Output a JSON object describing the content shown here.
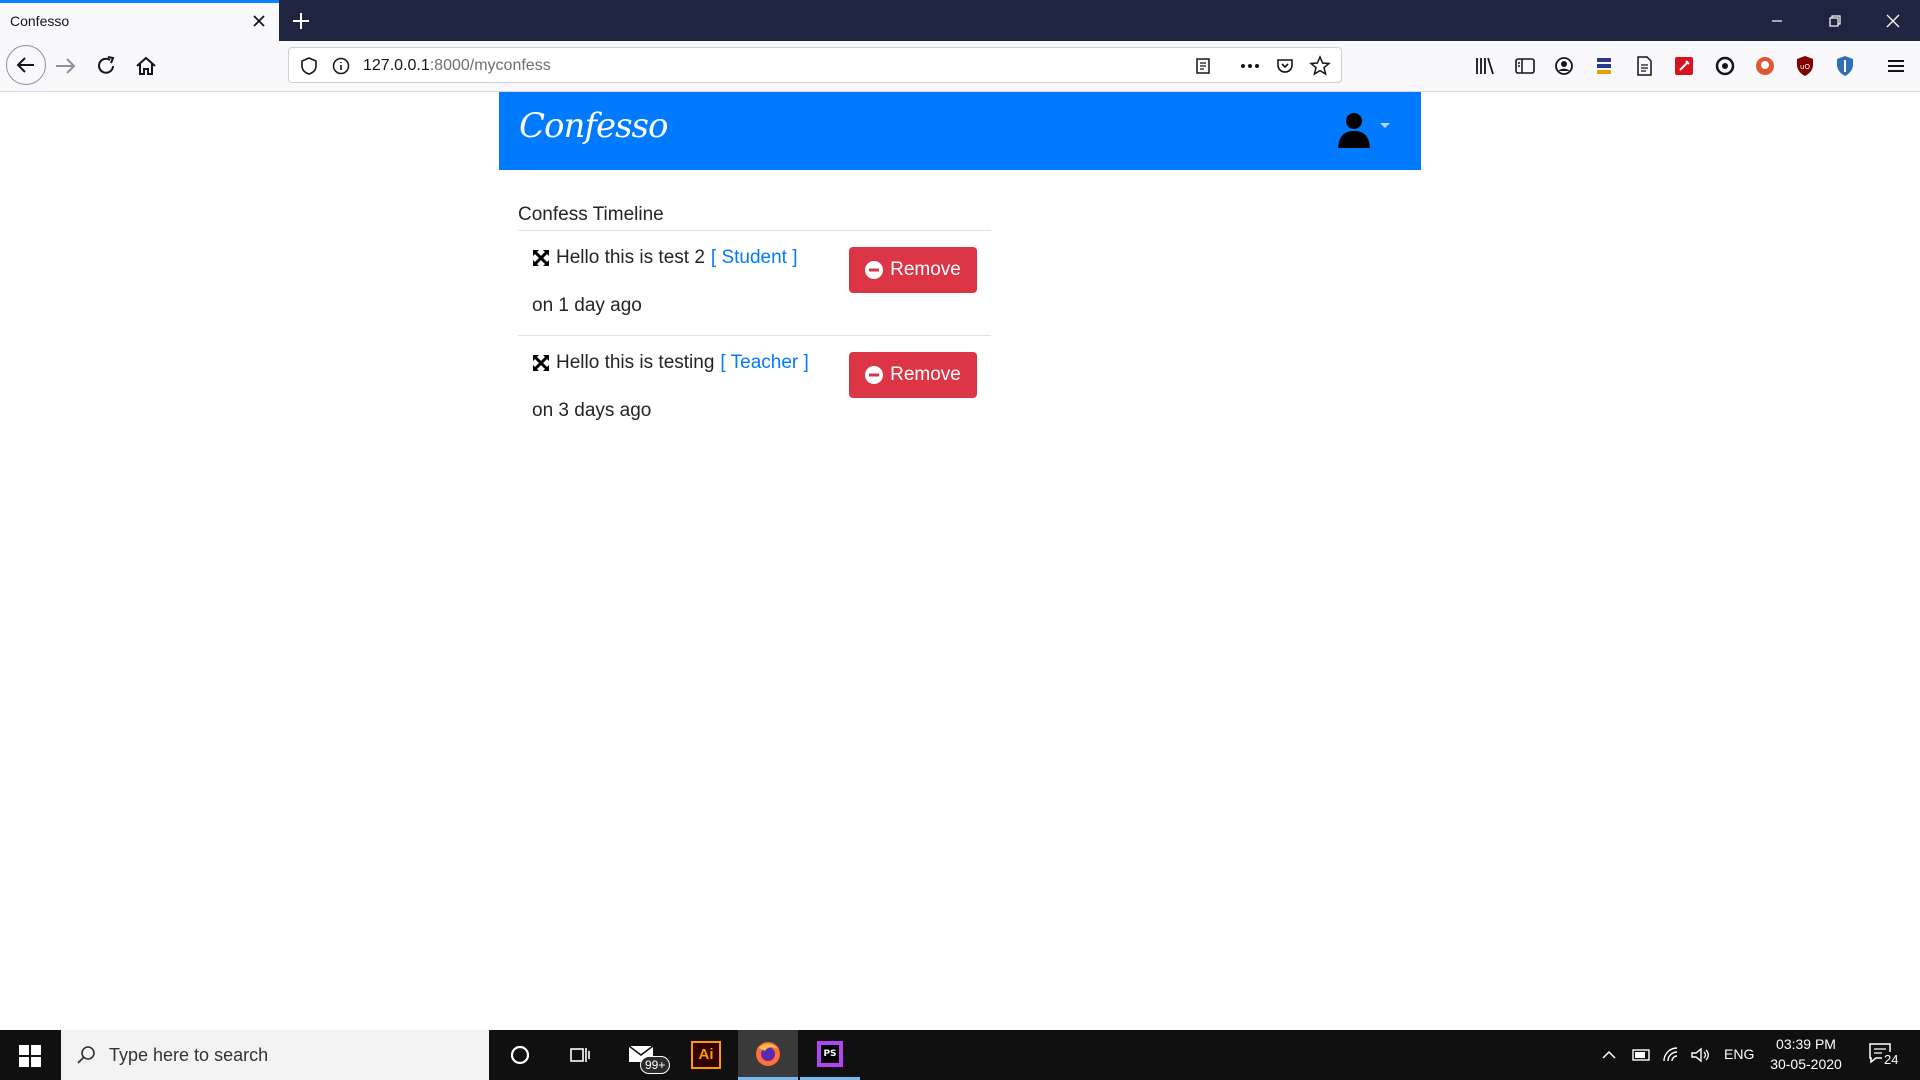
{
  "browser": {
    "tab_title": "Confesso",
    "url_host": "127.0.0.1",
    "url_path": ":8000/myconfess"
  },
  "site": {
    "logo": "Confesso",
    "timeline_title": "Confess Timeline",
    "posts": [
      {
        "text": "Hello this is test 2",
        "tag": "[ Student ]",
        "time": "on 1 day ago",
        "remove_label": "Remove"
      },
      {
        "text": "Hello this is testing",
        "tag": "[ Teacher ]",
        "time": "on 3 days ago",
        "remove_label": "Remove"
      }
    ]
  },
  "taskbar": {
    "search_placeholder": "Type here to search",
    "mail_badge": "99+",
    "illustrator_label": "Ai",
    "language": "ENG",
    "time": "03:39 PM",
    "date": "30-05-2020",
    "notifications": "24"
  },
  "colors": {
    "primary": "#007bff",
    "danger": "#dc3545",
    "tabbar": "#1f2440"
  }
}
